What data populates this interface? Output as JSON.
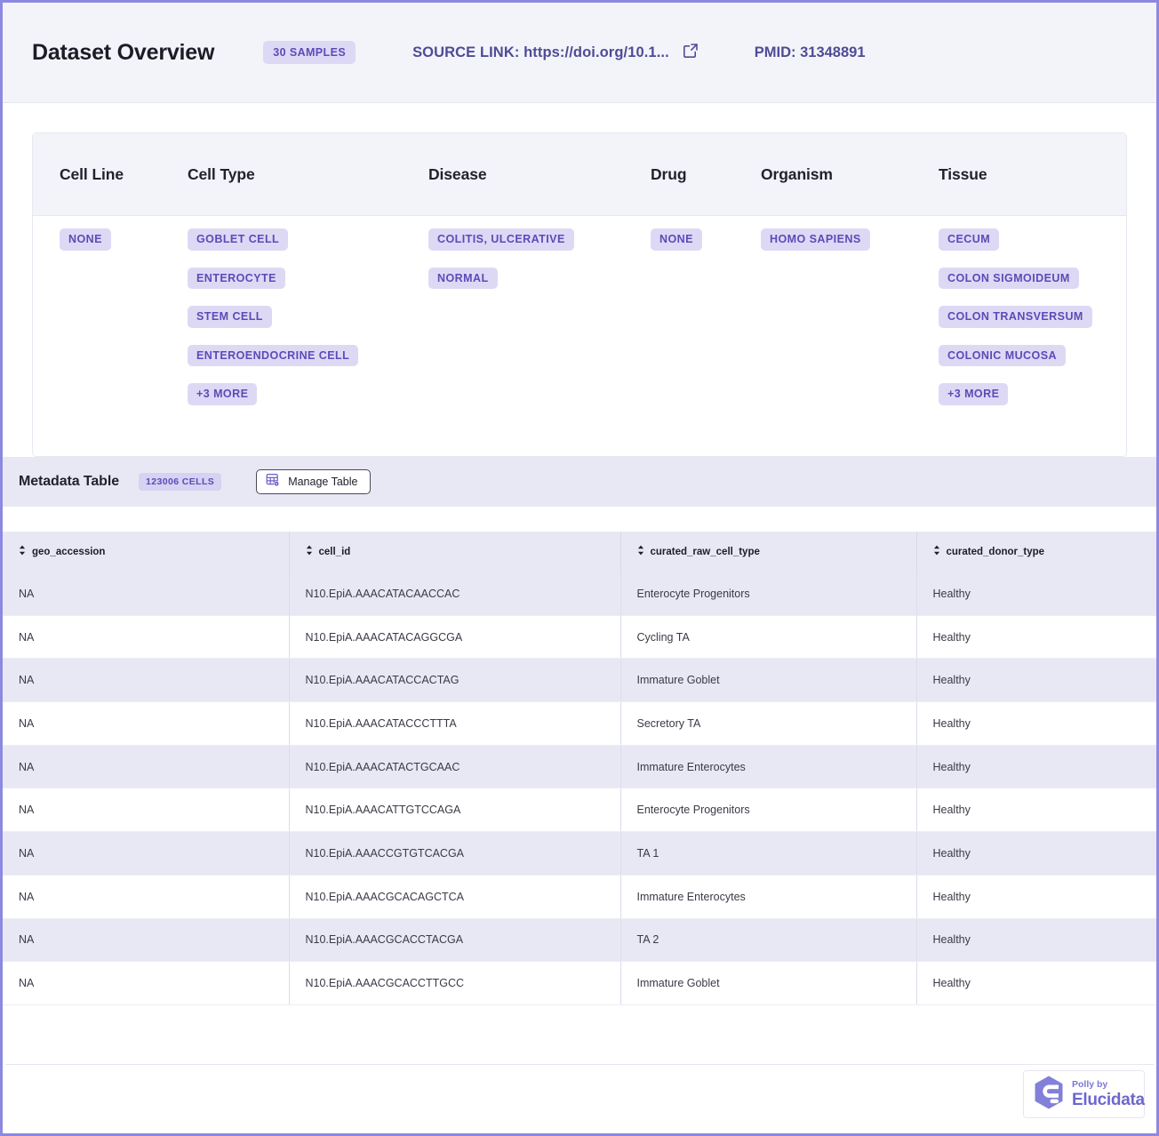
{
  "header": {
    "title": "Dataset Overview",
    "samples_badge": "30 SAMPLES",
    "source_link_label": "SOURCE LINK: https://doi.org/10.1...",
    "external_link_icon": "external-link-icon",
    "pmid_label": "PMID: 31348891"
  },
  "facets": {
    "columns": [
      {
        "title": "Cell Line",
        "chips": [
          "NONE"
        ]
      },
      {
        "title": "Cell Type",
        "chips": [
          "GOBLET CELL",
          "ENTEROCYTE",
          "STEM CELL",
          "ENTEROENDOCRINE CELL",
          "+3 MORE"
        ]
      },
      {
        "title": "Disease",
        "chips": [
          "COLITIS, ULCERATIVE",
          "NORMAL"
        ]
      },
      {
        "title": "Drug",
        "chips": [
          "NONE"
        ]
      },
      {
        "title": "Organism",
        "chips": [
          "HOMO SAPIENS"
        ]
      },
      {
        "title": "Tissue",
        "chips": [
          "CECUM",
          "COLON SIGMOIDEUM",
          "COLON TRANSVERSUM",
          "COLONIC MUCOSA",
          "+3 MORE"
        ]
      }
    ]
  },
  "metadata": {
    "title": "Metadata Table",
    "cells_badge": "123006 CELLS",
    "manage_button_label": "Manage Table",
    "manage_button_icon": "table-settings-icon"
  },
  "table": {
    "columns": [
      "geo_accession",
      "cell_id",
      "curated_raw_cell_type",
      "curated_donor_type"
    ],
    "rows": [
      [
        "NA",
        "N10.EpiA.AAACATACAACCAC",
        "Enterocyte Progenitors",
        "Healthy"
      ],
      [
        "NA",
        "N10.EpiA.AAACATACAGGCGA",
        "Cycling TA",
        "Healthy"
      ],
      [
        "NA",
        "N10.EpiA.AAACATACCACTAG",
        "Immature Goblet",
        "Healthy"
      ],
      [
        "NA",
        "N10.EpiA.AAACATACCCTTTA",
        "Secretory TA",
        "Healthy"
      ],
      [
        "NA",
        "N10.EpiA.AAACATACTGCAAC",
        "Immature Enterocytes",
        "Healthy"
      ],
      [
        "NA",
        "N10.EpiA.AAACATTGTCCAGA",
        "Enterocyte Progenitors",
        "Healthy"
      ],
      [
        "NA",
        "N10.EpiA.AAACCGTGTCACGA",
        "TA 1",
        "Healthy"
      ],
      [
        "NA",
        "N10.EpiA.AAACGCACAGCTCA",
        "Immature Enterocytes",
        "Healthy"
      ],
      [
        "NA",
        "N10.EpiA.AAACGCACCTACGA",
        "TA 2",
        "Healthy"
      ],
      [
        "NA",
        "N10.EpiA.AAACGCACCTTGCC",
        "Immature Goblet",
        "Healthy"
      ]
    ]
  },
  "footer": {
    "logo_sub": "Polly by",
    "logo_main": "Elucidata",
    "logo_icon": "polly-hexagon-logo"
  },
  "colors": {
    "accent_purple": "#5b4bb7",
    "chip_bg": "#ddd9f5",
    "band_bg": "#e8e8f5",
    "header_bg": "#f3f4f9",
    "page_border": "#8c89e0",
    "logo_purple": "#6b67cf"
  }
}
